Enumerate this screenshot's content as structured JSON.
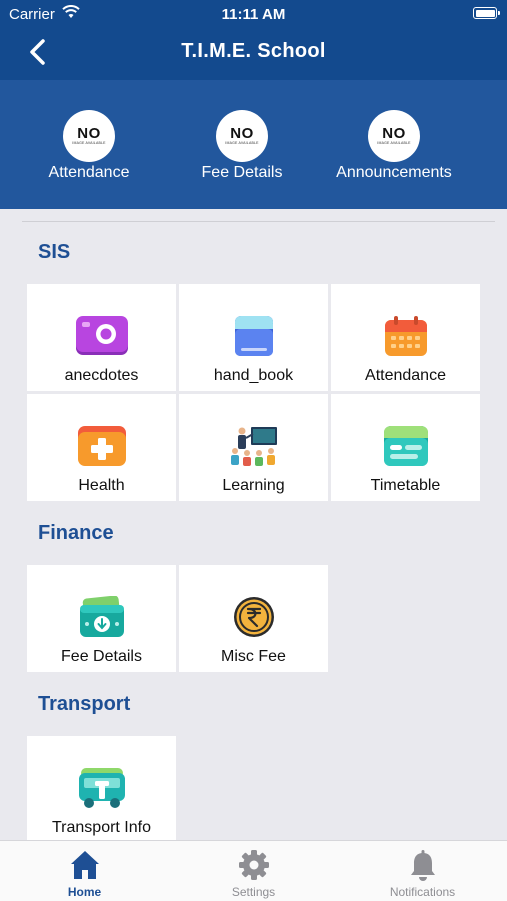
{
  "status_bar": {
    "carrier": "Carrier",
    "time": "11:11 AM"
  },
  "nav": {
    "title": "T.I.M.E. School"
  },
  "quick_links": [
    {
      "label": "Attendance",
      "image_text": "NO",
      "image_subtext": "IMAGE AVAILABLE"
    },
    {
      "label": "Fee Details",
      "image_text": "NO",
      "image_subtext": "IMAGE AVAILABLE"
    },
    {
      "label": "Announcements",
      "image_text": "NO",
      "image_subtext": "IMAGE AVAILABLE"
    }
  ],
  "sections": {
    "sis": {
      "title": "SIS",
      "items": [
        {
          "label": "anecdotes",
          "icon": "camera-icon"
        },
        {
          "label": "hand_book",
          "icon": "book-icon"
        },
        {
          "label": "Attendance",
          "icon": "calendar-icon"
        },
        {
          "label": "Health",
          "icon": "first-aid-icon"
        },
        {
          "label": "Learning",
          "icon": "classroom-icon"
        },
        {
          "label": "Timetable",
          "icon": "timetable-icon"
        }
      ]
    },
    "finance": {
      "title": "Finance",
      "items": [
        {
          "label": "Fee Details",
          "icon": "money-icon"
        },
        {
          "label": "Misc Fee",
          "icon": "rupee-coin-icon"
        }
      ]
    },
    "transport": {
      "title": "Transport",
      "items": [
        {
          "label": "Transport Info",
          "icon": "bus-icon"
        }
      ]
    }
  },
  "tab_bar": [
    {
      "label": "Home",
      "icon": "home-icon",
      "active": true
    },
    {
      "label": "Settings",
      "icon": "gear-icon",
      "active": false
    },
    {
      "label": "Notifications",
      "icon": "bell-icon",
      "active": false
    }
  ],
  "colors": {
    "header": "#134a8e",
    "quick_bar": "#22579d",
    "section_title": "#1e4f94",
    "tab_active": "#1e4f94",
    "tab_inactive": "#8e8e93"
  }
}
